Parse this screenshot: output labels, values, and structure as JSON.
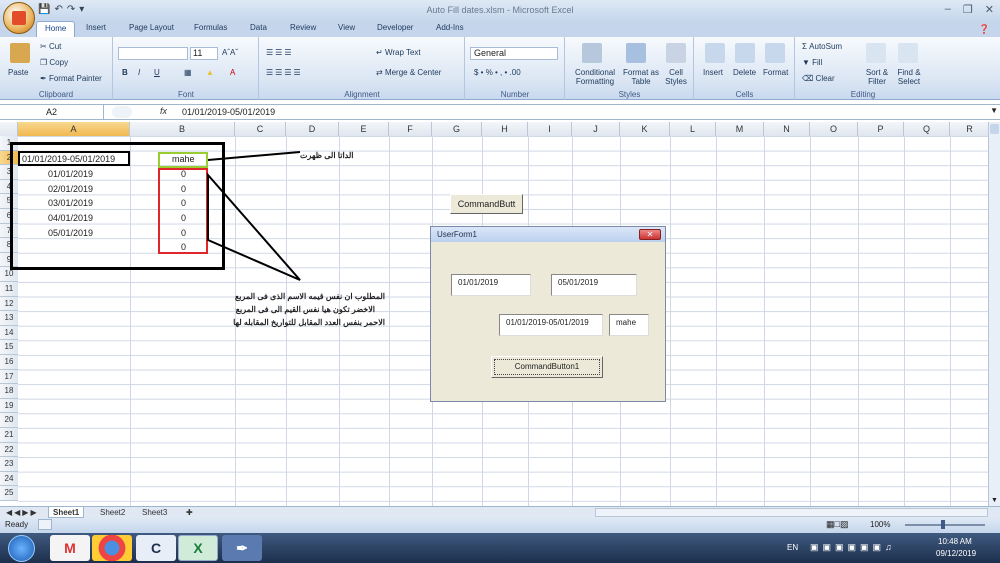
{
  "window": {
    "title": "Auto Fill dates.xlsm - Microsoft Excel"
  },
  "ribbon": {
    "tabs": [
      "Home",
      "Insert",
      "Page Layout",
      "Formulas",
      "Data",
      "Review",
      "View",
      "Developer",
      "Add-Ins"
    ],
    "clipboard": {
      "label": "Clipboard",
      "paste": "Paste",
      "cut": "Cut",
      "copy": "Copy",
      "format_painter": "Format Painter"
    },
    "font": {
      "label": "Font",
      "size": "11"
    },
    "alignment": {
      "label": "Alignment",
      "wrap": "Wrap Text",
      "merge": "Merge & Center"
    },
    "number": {
      "label": "Number",
      "format": "General"
    },
    "styles": {
      "label": "Styles",
      "conditional": "Conditional Formatting",
      "format_table": "Format as Table",
      "cell_styles": "Cell Styles"
    },
    "cells": {
      "label": "Cells",
      "insert": "Insert",
      "delete": "Delete",
      "format": "Format"
    },
    "editing": {
      "label": "Editing",
      "autosum": "AutoSum",
      "fill": "Fill",
      "clear": "Clear",
      "sort": "Sort & Filter",
      "find": "Find & Select"
    }
  },
  "formula_bar": {
    "name_box": "A2",
    "fx": "fx",
    "value": "01/01/2019-05/01/2019"
  },
  "columns": [
    "A",
    "B",
    "C",
    "D",
    "E",
    "F",
    "G",
    "H",
    "I",
    "J",
    "K",
    "L",
    "M",
    "N",
    "O",
    "P",
    "Q",
    "R"
  ],
  "rows": [
    "1",
    "2",
    "3",
    "4",
    "5",
    "6",
    "7",
    "8",
    "9",
    "10",
    "11",
    "12",
    "13",
    "14",
    "15",
    "16",
    "17",
    "18",
    "19",
    "20",
    "21",
    "22",
    "23",
    "24",
    "25"
  ],
  "cells": {
    "a2": "01/01/2019-05/01/2019",
    "b2": "mahe",
    "a3": "01/01/2019",
    "a4": "02/01/2019",
    "a5": "03/01/2019",
    "a6": "04/01/2019",
    "a7": "05/01/2019",
    "b3": "0",
    "b4": "0",
    "b5": "0",
    "b6": "0",
    "b7": "0",
    "b8": "0"
  },
  "annotations": {
    "note1": "الداتا الى ظهرت",
    "note2_line1": "المطلوب ان نفس قيمه الاسم الذى فى المربع",
    "note2_line2": "الاخضر تكون هيا نفس القيم الى فى المربع",
    "note2_line3": "الاحمر بنفس العدد المقابل للتواريخ المقابله لها"
  },
  "sheet_button": "CommandButt",
  "userform": {
    "title": "UserForm1",
    "textbox1": "01/01/2019",
    "textbox2": "05/01/2019",
    "textbox3": "01/01/2019-05/01/2019",
    "textbox4": "mahe",
    "button": "CommandButton1"
  },
  "sheets": [
    "Sheet1",
    "Sheet2",
    "Sheet3"
  ],
  "status": {
    "mode": "Ready",
    "zoom": "100%"
  },
  "taskbar": {
    "lang": "EN",
    "time": "10:48 AM",
    "date": "09/12/2019"
  },
  "colors": {
    "green_box": "#9acd32",
    "red_box": "#e0262b",
    "accent": "#15428b"
  }
}
